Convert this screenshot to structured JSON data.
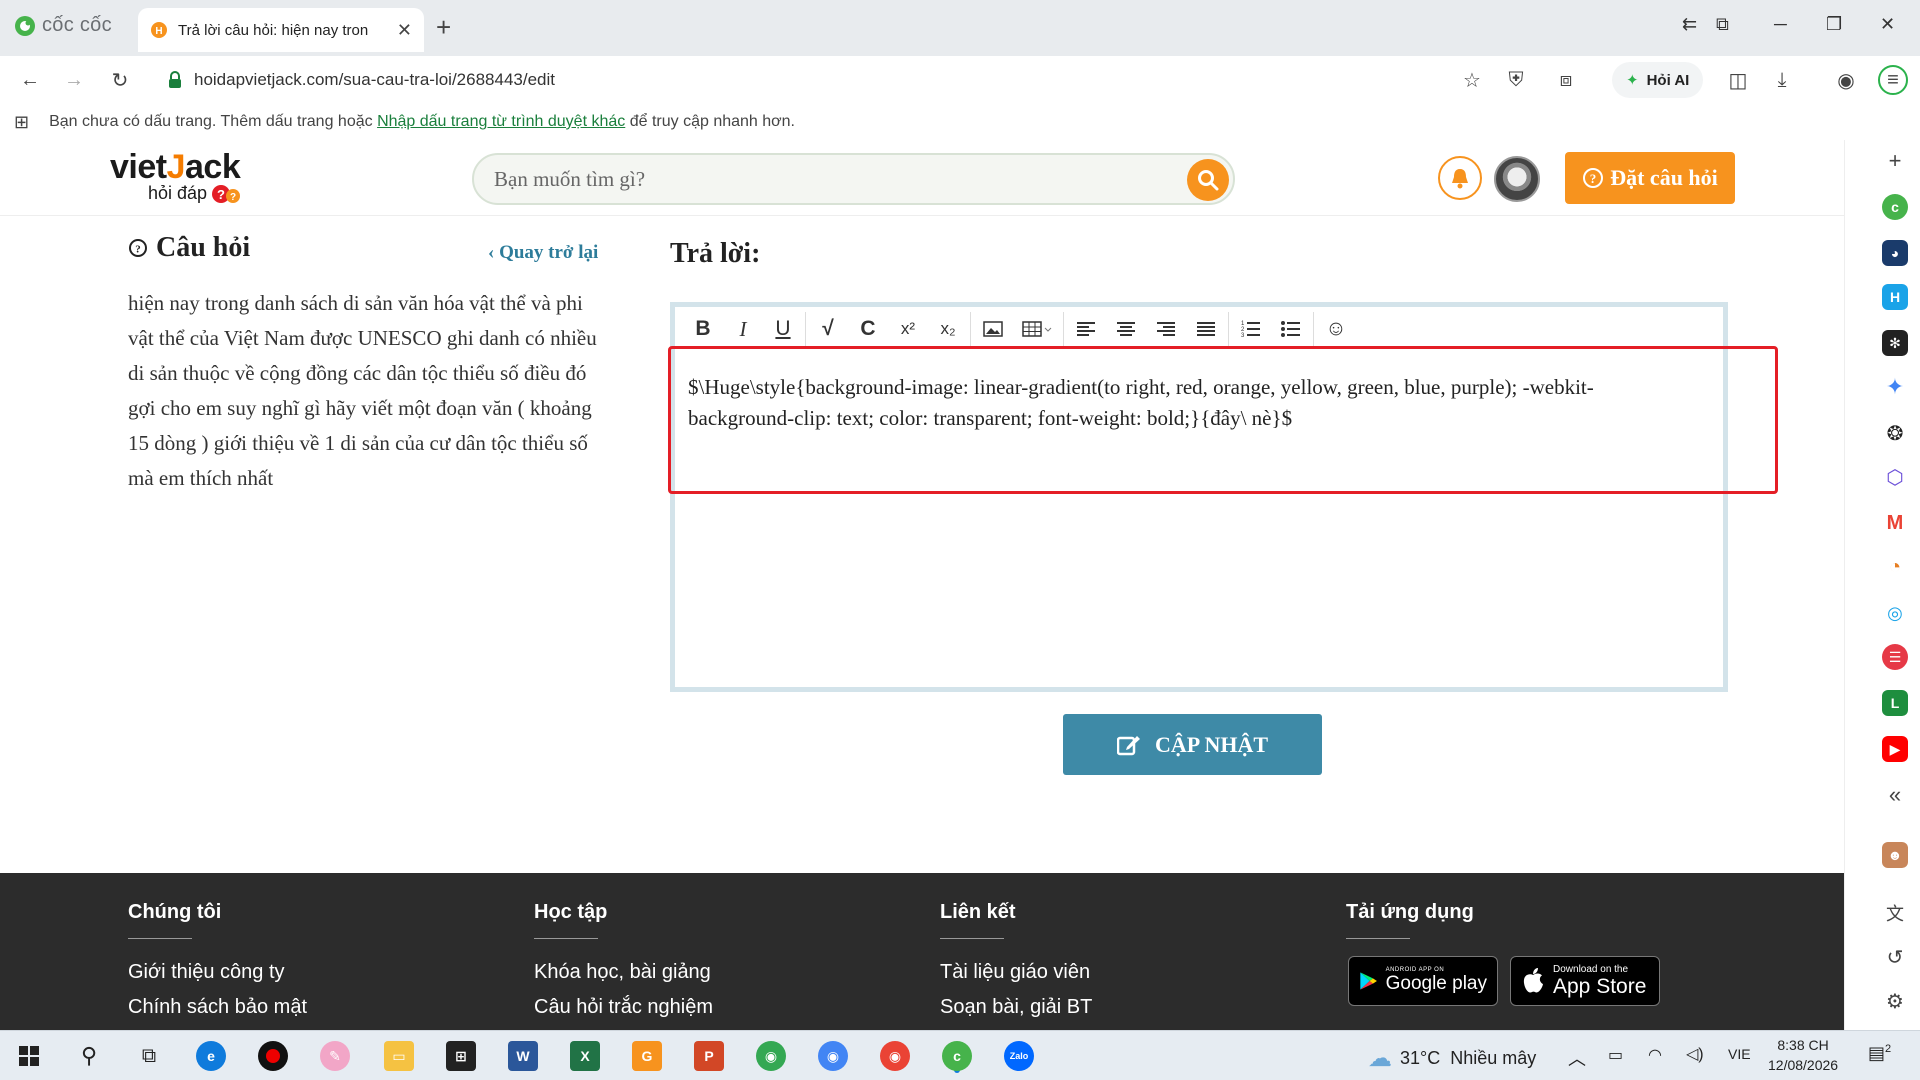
{
  "browser": {
    "brand": "cốc cốc",
    "tab_title": "Trả lời câu hỏi: hiện nay tron",
    "url": "hoidapvietjack.com/sua-cau-tra-loi/2688443/edit",
    "ask_ai_label": "Hỏi AI",
    "bookmark_bar": {
      "text_before": "Bạn chưa có dấu trang. Thêm dấu trang hoặc ",
      "link": "Nhập dấu trang từ trình duyệt khác",
      "text_after": " để truy cập nhanh hơn."
    }
  },
  "site": {
    "logo_main": "viet",
    "logo_accent": "J",
    "logo_rest": "ack",
    "logo_sub": "hỏi đáp",
    "search_placeholder": "Bạn muốn tìm gì?",
    "ask_button": "Đặt câu hỏi"
  },
  "question": {
    "heading": "Câu hỏi",
    "back_link": "Quay trở lại",
    "text": "hiện nay trong danh sách di sản văn hóa vật thể và phi vật thể của Việt Nam được UNESCO ghi danh có nhiều di sản thuộc về cộng đồng các dân tộc thiểu số điều đó gợi cho em suy nghĩ gì hãy viết một đoạn văn ( khoảng 15 dòng ) giới thiệu về 1 di sản của cư dân tộc thiểu số mà em thích nhất"
  },
  "answer": {
    "heading": "Trả lời:",
    "content": "$\\Huge\\style{background-image: linear-gradient(to right, red, orange, yellow, green, blue, purple); -webkit-background-clip: text; color: transparent; font-weight: bold;}{đây\\ nè}$",
    "update_button": "CẬP NHẬT"
  },
  "footer": {
    "columns": [
      {
        "heading": "Chúng tôi",
        "items": [
          "Giới thiệu công ty",
          "Chính sách bảo mật"
        ]
      },
      {
        "heading": "Học tập",
        "items": [
          "Khóa học, bài giảng",
          "Câu hỏi trắc nghiệm"
        ]
      },
      {
        "heading": "Liên kết",
        "items": [
          "Tài liệu giáo viên",
          "Soạn bài, giải BT"
        ]
      },
      {
        "heading": "Tải ứng dụng",
        "items": []
      }
    ],
    "google_play": {
      "small": "ANDROID APP ON",
      "big": "Google play"
    },
    "app_store": {
      "small": "Download on the",
      "big": "App Store"
    }
  },
  "taskbar": {
    "weather": "31°C  Nhiều mây",
    "lang": "VIE",
    "time": "8:38 CH",
    "date": "12/08/2026",
    "notif_count": "2"
  },
  "colors": {
    "accent_orange": "#f7931e",
    "button_blue": "#3e8aa7",
    "highlight_red": "#e41e26",
    "footer_bg": "#2c2c2c"
  }
}
